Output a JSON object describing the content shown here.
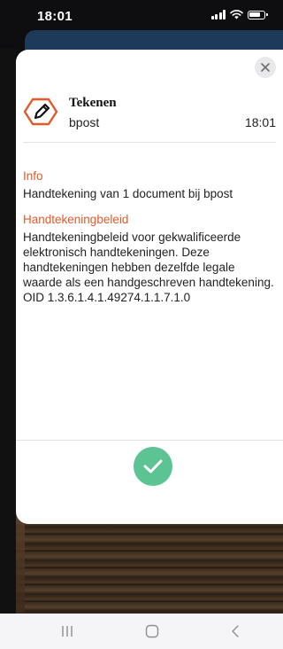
{
  "status_bar": {
    "time": "18:01"
  },
  "sheet": {
    "app_name": "Tekenen",
    "org": "bpost",
    "time": "18:01",
    "info": {
      "title": "Info",
      "text": "Handtekening van 1 document bij bpost"
    },
    "policy": {
      "title": "Handtekeningbeleid",
      "lines": [
        "Handtekeningbeleid voor gekwalificeerde",
        "elektronisch handtekeningen. Deze",
        "handtekeningen hebben dezelfde legale",
        "waarde als een handgeschreven handtekening.",
        "OID 1.3.6.1.4.1.49274.1.1.7.1.0"
      ]
    }
  },
  "colors": {
    "accent": "#e35a2b",
    "confirm": "#5cc393",
    "bg_card": "#1e3a5a"
  },
  "icons": [
    "signal-icon",
    "wifi-icon",
    "battery-icon",
    "close-icon",
    "pen-icon",
    "checkmark-icon",
    "recent-apps-icon",
    "home-icon",
    "back-icon"
  ]
}
